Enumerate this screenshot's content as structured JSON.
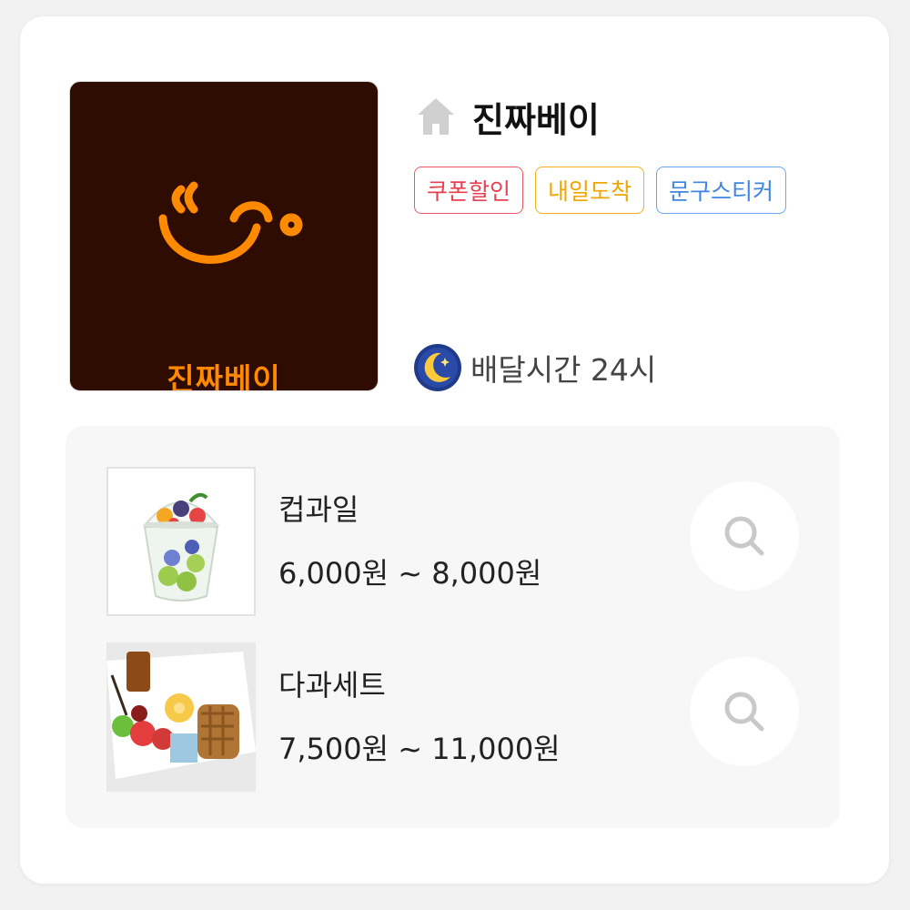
{
  "store": {
    "name": "진짜베이",
    "logo_text": "진짜베이"
  },
  "tags": [
    {
      "label": "쿠폰할인",
      "color": "#e8404f"
    },
    {
      "label": "내일도착",
      "color": "#f0a500"
    },
    {
      "label": "문구스티커",
      "color": "#3f86e4"
    }
  ],
  "delivery": {
    "text": "배달시간 24시",
    "icon": "moon-icon"
  },
  "menu": [
    {
      "name": "컵과일",
      "price": "6,000원 ~ 8,000원",
      "icon": "search-icon"
    },
    {
      "name": "다과세트",
      "price": "7,500원 ~ 11,000원",
      "icon": "search-icon"
    }
  ],
  "colors": {
    "logo_bg": "#2e0c01",
    "logo_accent": "#ff8a00",
    "panel_bg": "#f7f7f7"
  }
}
